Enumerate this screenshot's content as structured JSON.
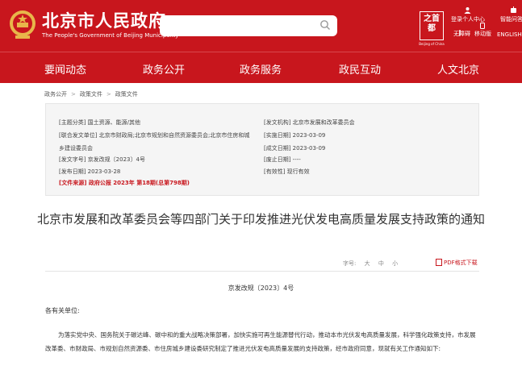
{
  "header": {
    "title": "北京市人民政府",
    "subtitle": "The People's Government of Beijing Municipality",
    "seal_chars": "之首都",
    "seal_caption": "Beijing of China",
    "login_label": "登录个人中心",
    "accessible_label": "无障碍",
    "mobile_label": "移动版",
    "robot_label": "智能问答",
    "english_label": "ENGLISH"
  },
  "search": {
    "placeholder": ""
  },
  "nav": {
    "items": [
      "要闻动态",
      "政务公开",
      "政务服务",
      "政民互动",
      "人文北京"
    ]
  },
  "breadcrumb": {
    "items": [
      "政务公开",
      "政策文件",
      "政策文件"
    ]
  },
  "meta": {
    "topic": "[主题分类] 国土资源、能源/其他",
    "issuer": "[发文机构] 北京市发展和改革委员会",
    "joint_line1": "[联合发文单位] 北京市财政局;北京市规划和自然资源委员会;北京市住房和城",
    "joint_line2": "乡建设委员会",
    "effective_date": "[实施日期] 2023-03-09",
    "written_date": "[成文日期] 2023-03-09",
    "doc_no": "[发文字号] 京发改规〔2023〕4号",
    "expiry": "[废止日期] ----",
    "publish_date": "[发布日期] 2023-03-28",
    "validity": "[有效性] 现行有效",
    "source": "[文件来源] 政府公报 2023年 第18期(总第798期)"
  },
  "article": {
    "title": "北京市发展和改革委员会等四部门关于印发推进光伏发电高质量发展支持政策的通知",
    "font_label": "字号:",
    "font_sizes": [
      "大",
      "中",
      "小"
    ],
    "pdf_label": "PDF格式下载",
    "doc_number": "京发改规〔2023〕4号",
    "salutation": "各有关单位:",
    "body": "为落实党中央、国务院关于碳达峰、碳中和的重大战略决策部署，加快实施可再生能源替代行动，推动本市光伏发电高质量发展，科学强化政策支持，市发展改革委、市财政局、市规划自然资源委、市住房城乡建设委研究制定了推进光伏发电高质量发展的支持政策，经市政府同意，现就有关工作通知如下:"
  },
  "colors": {
    "brand_red": "#c8161d",
    "meta_bg": "#f5f5f5"
  }
}
